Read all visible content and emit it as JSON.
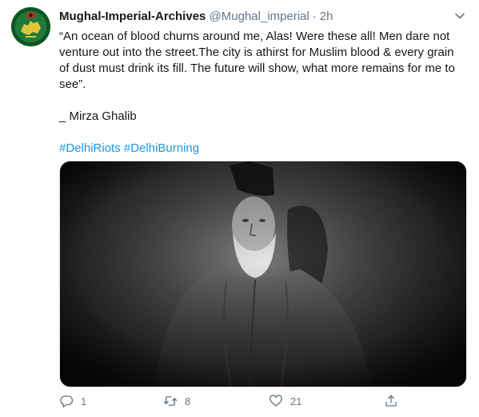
{
  "tweet": {
    "display_name": "Mughal-Imperial-Archives",
    "handle": "@Mughal_imperial",
    "separator": "·",
    "time": "2h",
    "quote": "“An ocean of blood churns around me, Alas! Were these all! Men dare not venture out into the street.The city is athirst for Muslim blood & every grain of dust must drink its fill. The future will show, what more remains for me to see”.",
    "signature": "_ Mirza Ghalib",
    "hashtags": [
      "#DelhiRiots",
      "#DelhiBurning"
    ]
  },
  "actions": {
    "reply_count": "1",
    "retweet_count": "8",
    "like_count": "21"
  },
  "icons": {
    "more": "chevron-down-icon",
    "reply": "reply-icon",
    "retweet": "retweet-icon",
    "like": "heart-icon",
    "share": "share-icon"
  },
  "colors": {
    "text": "#14171a",
    "muted": "#657786",
    "link": "#1b95e0",
    "avatar_bg": "#1e7a3a"
  }
}
